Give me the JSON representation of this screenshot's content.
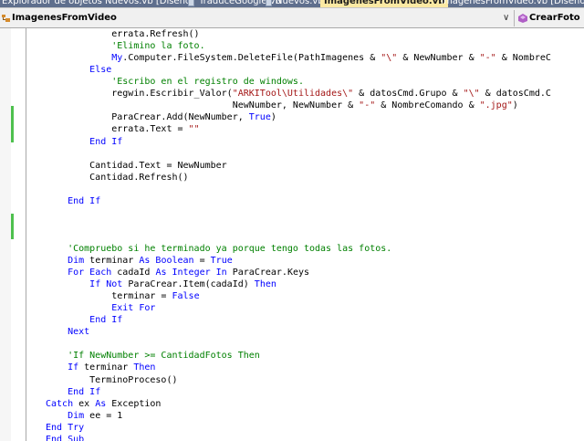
{
  "tabs": [
    {
      "label": "Explorador de objetos",
      "active": false
    },
    {
      "label": "Nuevos.vb [Diseño]",
      "active": false
    },
    {
      "label": "TraduceGoogle.vb",
      "active": false
    },
    {
      "label": "Nuevos.vb",
      "active": false
    },
    {
      "label": "ImagenesFromVideo.vb",
      "active": true
    },
    {
      "label": "ImagenesFromVideo.vb [Diseño]",
      "active": false
    }
  ],
  "navbar": {
    "class_combo": "ImagenesFromVideo",
    "class_icon": "class-icon",
    "member_combo": "CrearFoto",
    "member_icon": "method-icon",
    "dropdown_icon": "chevron-down-icon"
  },
  "colors": {
    "keyword": "#0000ff",
    "comment": "#008000",
    "string": "#a31515",
    "changed_line_marker": "#4ec04e",
    "active_tab": "#fbe9a3",
    "tab_bar": "#5f6f8d"
  },
  "code_lines": [
    [
      {
        "t": "            errata.Refresh()",
        "c": ""
      }
    ],
    [
      {
        "t": "            'Elimino la foto.",
        "c": "cm"
      }
    ],
    [
      {
        "t": "            ",
        "c": ""
      },
      {
        "t": "My",
        "c": "kw"
      },
      {
        "t": ".Computer.FileSystem.DeleteFile(PathImagenes & ",
        "c": ""
      },
      {
        "t": "\"\\\"",
        "c": "st"
      },
      {
        "t": " & NewNumber & ",
        "c": ""
      },
      {
        "t": "\"-\"",
        "c": "st"
      },
      {
        "t": " & NombreC",
        "c": ""
      }
    ],
    [
      {
        "t": "        ",
        "c": ""
      },
      {
        "t": "Else",
        "c": "kw"
      }
    ],
    [
      {
        "t": "            'Escribo en el registro de windows.",
        "c": "cm"
      }
    ],
    [
      {
        "t": "            regwin.Escribir_Valor(",
        "c": ""
      },
      {
        "t": "\"ARKITool\\Utilidades\\\"",
        "c": "st"
      },
      {
        "t": " & datosCmd.Grupo & ",
        "c": ""
      },
      {
        "t": "\"\\\"",
        "c": "st"
      },
      {
        "t": " & datosCmd.C",
        "c": ""
      }
    ],
    [
      {
        "t": "                                  NewNumber, NewNumber & ",
        "c": ""
      },
      {
        "t": "\"-\"",
        "c": "st"
      },
      {
        "t": " & NombreComando & ",
        "c": ""
      },
      {
        "t": "\".jpg\"",
        "c": "st"
      },
      {
        "t": ")",
        "c": ""
      }
    ],
    [
      {
        "t": "            ParaCrear.Add(NewNumber, ",
        "c": ""
      },
      {
        "t": "True",
        "c": "kw"
      },
      {
        "t": ")",
        "c": ""
      }
    ],
    [
      {
        "t": "            errata.Text = ",
        "c": ""
      },
      {
        "t": "\"\"",
        "c": "st"
      }
    ],
    [
      {
        "t": "        ",
        "c": ""
      },
      {
        "t": "End If",
        "c": "kw"
      }
    ],
    [
      {
        "t": "",
        "c": ""
      }
    ],
    [
      {
        "t": "        Cantidad.Text = NewNumber",
        "c": ""
      }
    ],
    [
      {
        "t": "        Cantidad.Refresh()",
        "c": ""
      }
    ],
    [
      {
        "t": "",
        "c": ""
      }
    ],
    [
      {
        "t": "    ",
        "c": ""
      },
      {
        "t": "End If",
        "c": "kw"
      }
    ],
    [
      {
        "t": "",
        "c": ""
      }
    ],
    [
      {
        "t": "",
        "c": ""
      }
    ],
    [
      {
        "t": "",
        "c": ""
      }
    ],
    [
      {
        "t": "    'Compruebo si he terminado ya porque tengo todas las fotos.",
        "c": "cm"
      }
    ],
    [
      {
        "t": "    ",
        "c": ""
      },
      {
        "t": "Dim",
        "c": "kw"
      },
      {
        "t": " terminar ",
        "c": ""
      },
      {
        "t": "As Boolean",
        "c": "kw"
      },
      {
        "t": " = ",
        "c": ""
      },
      {
        "t": "True",
        "c": "kw"
      }
    ],
    [
      {
        "t": "    ",
        "c": ""
      },
      {
        "t": "For Each",
        "c": "kw"
      },
      {
        "t": " cadaId ",
        "c": ""
      },
      {
        "t": "As Integer In",
        "c": "kw"
      },
      {
        "t": " ParaCrear.Keys",
        "c": ""
      }
    ],
    [
      {
        "t": "        ",
        "c": ""
      },
      {
        "t": "If Not",
        "c": "kw"
      },
      {
        "t": " ParaCrear.Item(cadaId) ",
        "c": ""
      },
      {
        "t": "Then",
        "c": "kw"
      }
    ],
    [
      {
        "t": "            terminar = ",
        "c": ""
      },
      {
        "t": "False",
        "c": "kw"
      }
    ],
    [
      {
        "t": "            ",
        "c": ""
      },
      {
        "t": "Exit For",
        "c": "kw"
      }
    ],
    [
      {
        "t": "        ",
        "c": ""
      },
      {
        "t": "End If",
        "c": "kw"
      }
    ],
    [
      {
        "t": "    ",
        "c": ""
      },
      {
        "t": "Next",
        "c": "kw"
      }
    ],
    [
      {
        "t": "",
        "c": ""
      }
    ],
    [
      {
        "t": "    'If NewNumber >= CantidadFotos Then",
        "c": "cm"
      }
    ],
    [
      {
        "t": "    ",
        "c": ""
      },
      {
        "t": "If",
        "c": "kw"
      },
      {
        "t": " terminar ",
        "c": ""
      },
      {
        "t": "Then",
        "c": "kw"
      }
    ],
    [
      {
        "t": "        TerminoProceso()",
        "c": ""
      }
    ],
    [
      {
        "t": "    ",
        "c": ""
      },
      {
        "t": "End If",
        "c": "kw"
      }
    ],
    [
      {
        "t": "",
        "c": ""
      },
      {
        "t": "Catch",
        "c": "kw"
      },
      {
        "t": " ex ",
        "c": ""
      },
      {
        "t": "As",
        "c": "kw"
      },
      {
        "t": " Exception",
        "c": ""
      }
    ],
    [
      {
        "t": "    ",
        "c": ""
      },
      {
        "t": "Dim",
        "c": "kw"
      },
      {
        "t": " ee = 1",
        "c": ""
      }
    ],
    [
      {
        "t": "",
        "c": ""
      },
      {
        "t": "End Try",
        "c": "kw"
      }
    ],
    [
      {
        "t": "",
        "c": ""
      },
      {
        "t": "End Sub",
        "c": "kw"
      }
    ]
  ]
}
